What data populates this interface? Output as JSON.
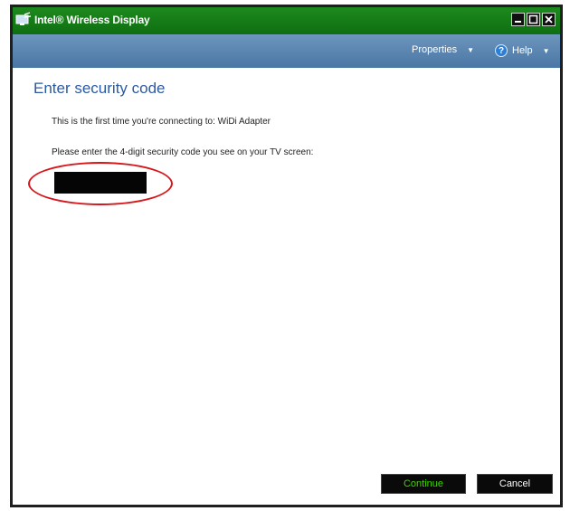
{
  "window": {
    "title": "Intel® Wireless Display"
  },
  "menubar": {
    "properties_label": "Properties",
    "help_label": "Help"
  },
  "content": {
    "heading": "Enter security code",
    "connecting_text": "This is the first time you're connecting to:  WiDi Adapter",
    "instruction_text": "Please enter the 4-digit security code you see on your TV screen:",
    "code_value": ""
  },
  "buttons": {
    "continue_label": "Continue",
    "cancel_label": "Cancel"
  },
  "colors": {
    "titlebar": "#0f6e11",
    "menubar": "#4a76a4",
    "heading": "#2b5aa4",
    "highlight": "#d7161b",
    "continue_text": "#3fd400"
  }
}
